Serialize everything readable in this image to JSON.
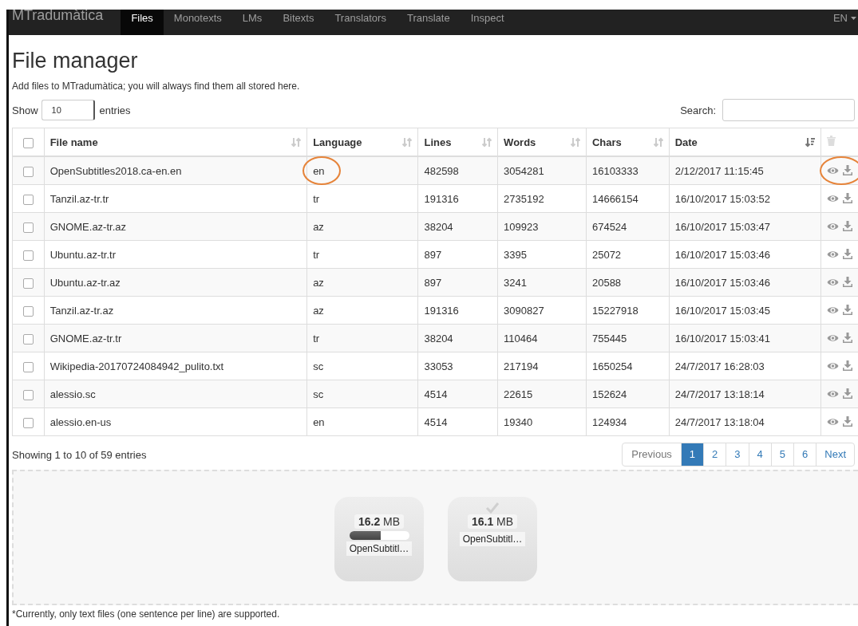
{
  "navbar": {
    "brand": "MTradumàtica",
    "items": [
      {
        "label": "Files",
        "selected": true
      },
      {
        "label": "Monotexts",
        "selected": false
      },
      {
        "label": "LMs",
        "selected": false
      },
      {
        "label": "Bitexts",
        "selected": false
      },
      {
        "label": "Translators",
        "selected": false
      },
      {
        "label": "Translate",
        "selected": false
      },
      {
        "label": "Inspect",
        "selected": false
      }
    ],
    "language": "EN"
  },
  "title": "File manager",
  "subtitle": "Add files to MTradumàtica; you will always find them all stored here.",
  "length_control": {
    "before": "Show",
    "value": "10",
    "after": "entries"
  },
  "search": {
    "label": "Search:"
  },
  "table": {
    "select_all_checked": false,
    "columns": [
      {
        "label": "File name",
        "sorted": false
      },
      {
        "label": "Language",
        "sorted": false
      },
      {
        "label": "Lines",
        "sorted": false
      },
      {
        "label": "Words",
        "sorted": false
      },
      {
        "label": "Chars",
        "sorted": false
      },
      {
        "label": "Date",
        "sorted": true
      }
    ],
    "rows": [
      {
        "checked": false,
        "cells": [
          "OpenSubtitles2018.ca-en.en",
          "en",
          "482598",
          "3054281",
          "16103333",
          "2/12/2017 11:15:45"
        ],
        "language_circled": true,
        "actions_circled": true
      },
      {
        "checked": false,
        "cells": [
          "Tanzil.az-tr.tr",
          "tr",
          "191316",
          "2735192",
          "14666154",
          "16/10/2017 15:03:52"
        ],
        "language_circled": false,
        "actions_circled": false
      },
      {
        "checked": false,
        "cells": [
          "GNOME.az-tr.az",
          "az",
          "38204",
          "109923",
          "674524",
          "16/10/2017 15:03:47"
        ],
        "language_circled": false,
        "actions_circled": false
      },
      {
        "checked": false,
        "cells": [
          "Ubuntu.az-tr.tr",
          "tr",
          "897",
          "3395",
          "25072",
          "16/10/2017 15:03:46"
        ],
        "language_circled": false,
        "actions_circled": false
      },
      {
        "checked": false,
        "cells": [
          "Ubuntu.az-tr.az",
          "az",
          "897",
          "3241",
          "20588",
          "16/10/2017 15:03:46"
        ],
        "language_circled": false,
        "actions_circled": false
      },
      {
        "checked": false,
        "cells": [
          "Tanzil.az-tr.az",
          "az",
          "191316",
          "3090827",
          "15227918",
          "16/10/2017 15:03:45"
        ],
        "language_circled": false,
        "actions_circled": false
      },
      {
        "checked": false,
        "cells": [
          "GNOME.az-tr.tr",
          "tr",
          "38204",
          "110464",
          "755445",
          "16/10/2017 15:03:41"
        ],
        "language_circled": false,
        "actions_circled": false
      },
      {
        "checked": false,
        "cells": [
          "Wikipedia-20170724084942_pulito.txt",
          "sc",
          "33053",
          "217194",
          "1650254",
          "24/7/2017 16:28:03"
        ],
        "language_circled": false,
        "actions_circled": false
      },
      {
        "checked": false,
        "cells": [
          "alessio.sc",
          "sc",
          "4514",
          "22615",
          "152624",
          "24/7/2017 13:18:14"
        ],
        "language_circled": false,
        "actions_circled": false
      },
      {
        "checked": false,
        "cells": [
          "alessio.en-us",
          "en",
          "4514",
          "19340",
          "124934",
          "24/7/2017 13:18:04"
        ],
        "language_circled": false,
        "actions_circled": false
      }
    ]
  },
  "info": "Showing 1 to 10 of 59 entries",
  "pagination": [
    {
      "label": "Previous",
      "selected": false,
      "disabled": true
    },
    {
      "label": "1",
      "selected": true,
      "disabled": false
    },
    {
      "label": "2",
      "selected": false,
      "disabled": false
    },
    {
      "label": "3",
      "selected": false,
      "disabled": false
    },
    {
      "label": "4",
      "selected": false,
      "disabled": false
    },
    {
      "label": "5",
      "selected": false,
      "disabled": false
    },
    {
      "label": "6",
      "selected": false,
      "disabled": false
    },
    {
      "label": "Next",
      "selected": false,
      "disabled": false
    }
  ],
  "uploads": [
    {
      "size": "16.2",
      "unit": "MB",
      "name": "OpenSubtitl…",
      "kind": "uploading",
      "level": 0.52
    },
    {
      "size": "16.1",
      "unit": "MB",
      "name": "OpenSubtitl…",
      "kind": "done"
    }
  ],
  "footnote": "*Currently, only text files (one sentence per line) are supported."
}
